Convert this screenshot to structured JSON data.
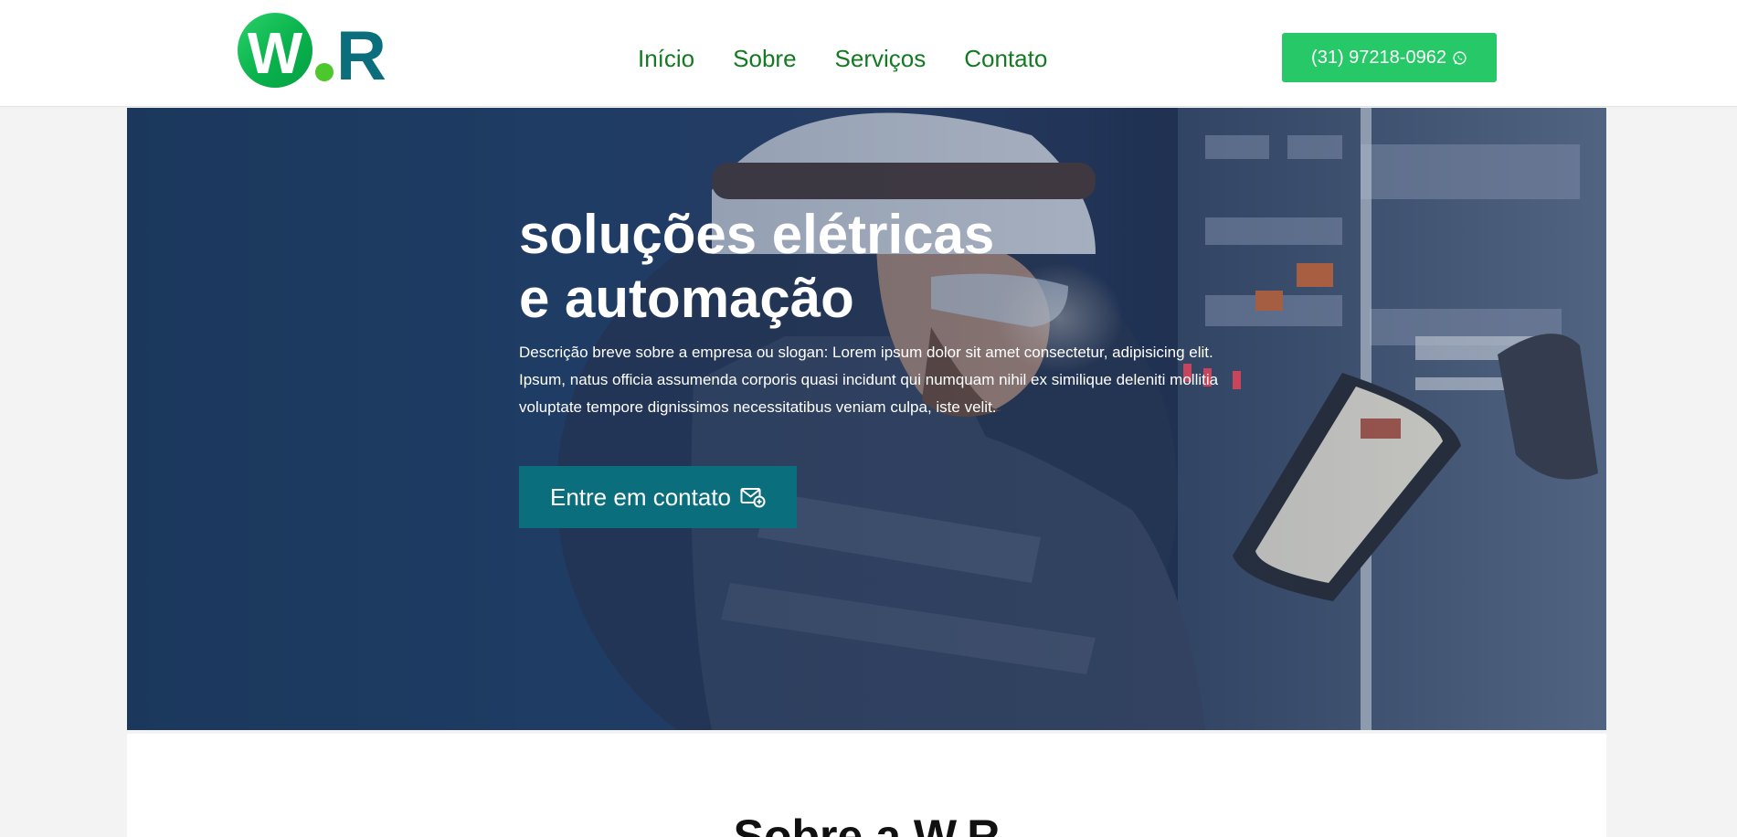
{
  "header": {
    "logo": {
      "letter_w": "W",
      "letter_r": "R"
    },
    "nav": [
      {
        "label": "Início"
      },
      {
        "label": "Sobre"
      },
      {
        "label": "Serviços"
      },
      {
        "label": "Contato"
      }
    ],
    "phone_button": {
      "label": "(31) 97218-0962",
      "icon": "whatsapp-icon"
    }
  },
  "hero": {
    "title_line1": "soluções elétricas",
    "title_line2": "e automação",
    "description": "Descrição breve sobre a empresa ou slogan: Lorem ipsum dolor sit amet consectetur, adipisicing elit. Ipsum, natus officia assumenda corporis quasi incidunt qui numquam nihil ex similique deleniti mollitia voluptate tempore dignissimos necessitatibus veniam culpa, iste velit.",
    "cta_label": "Entre em contato",
    "cta_icon": "mail-icon"
  },
  "about": {
    "title": "Sobre a W.R"
  },
  "colors": {
    "nav_text": "#137a22",
    "phone_button_bg": "#27c867",
    "cta_bg": "#0b6e7d",
    "logo_green": "#09b24c",
    "logo_teal": "#0b6e7d"
  }
}
